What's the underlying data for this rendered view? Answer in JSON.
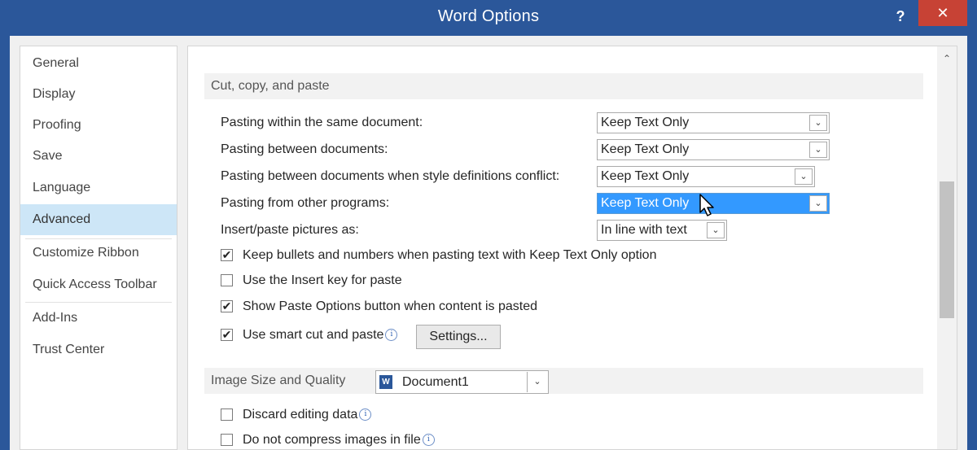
{
  "window": {
    "title": "Word Options",
    "help_label": "?",
    "close_label": "✕",
    "frame_color": "#2b579a",
    "close_color": "#c74235"
  },
  "nav": {
    "items": [
      {
        "label": "General",
        "selected": false
      },
      {
        "label": "Display",
        "selected": false
      },
      {
        "label": "Proofing",
        "selected": false
      },
      {
        "label": "Save",
        "selected": false
      },
      {
        "label": "Language",
        "selected": false
      },
      {
        "label": "Advanced",
        "selected": true
      },
      {
        "label": "Customize Ribbon",
        "selected": false
      },
      {
        "label": "Quick Access Toolbar",
        "selected": false
      },
      {
        "label": "Add-Ins",
        "selected": false
      },
      {
        "label": "Trust Center",
        "selected": false
      }
    ],
    "selected_color": "#cde6f7"
  },
  "cut_copy_paste": {
    "header": "Cut, copy, and paste",
    "pasting_within": {
      "label": "Pasting within the same document:",
      "value": "Keep Text Only"
    },
    "pasting_between": {
      "label": "Pasting between documents:",
      "value": "Keep Text Only"
    },
    "pasting_conflict": {
      "label": "Pasting between documents when style definitions conflict:",
      "value": "Keep Text Only"
    },
    "pasting_other": {
      "label": "Pasting from other programs:",
      "value": "Keep Text Only"
    },
    "insert_pictures": {
      "label": "Insert/paste pictures as:",
      "value": "In line with text"
    },
    "keep_bullets": {
      "label": "Keep bullets and numbers when pasting text with Keep Text Only option",
      "checked": true
    },
    "insert_key": {
      "label": "Use the Insert key for paste",
      "checked": false
    },
    "show_paste_options": {
      "label": "Show Paste Options button when content is pasted",
      "checked": true
    },
    "smart_cut": {
      "label": "Use smart cut and paste",
      "checked": true
    },
    "settings_button": "Settings..."
  },
  "image_size": {
    "header": "Image Size and Quality",
    "document": "Document1",
    "document_icon": "W",
    "discard_editing": {
      "label": "Discard editing data",
      "checked": false
    },
    "no_compress": {
      "label": "Do not compress images in file",
      "checked": false
    }
  },
  "icons": {
    "info": "i",
    "check": "✔",
    "dropdown": "⌄",
    "scroll_up": "⌃"
  },
  "highlight_color": "#3399ff"
}
